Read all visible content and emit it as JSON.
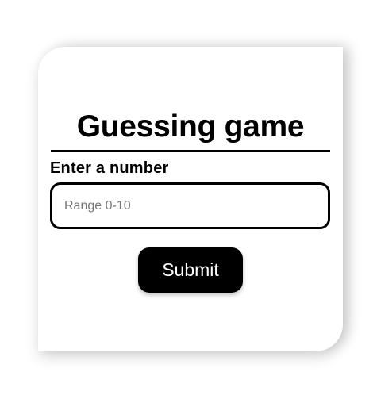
{
  "game": {
    "title": "Guessing game",
    "input_label": "Enter a number",
    "input_placeholder": "Range 0-10",
    "input_value": "",
    "submit_label": "Submit"
  },
  "colors": {
    "background": "#ffffff",
    "text": "#000000",
    "button_background": "#000000",
    "button_text": "#ffffff",
    "placeholder": "#777777"
  }
}
